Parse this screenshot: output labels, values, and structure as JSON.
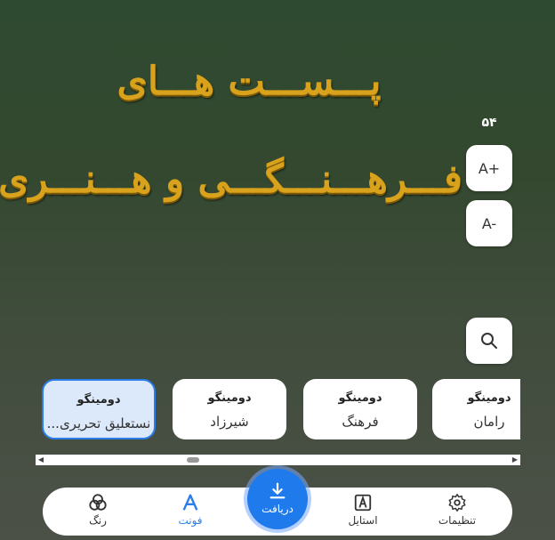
{
  "canvas": {
    "line1": "پـــســـت هـــای",
    "line2": "فـــرهـــنـــگـــی و هـــنـــری",
    "text_color": "#d9a21c"
  },
  "size_controls": {
    "current_size": "۵۴",
    "increase_label": "A+",
    "decrease_label": "A-"
  },
  "fonts": [
    {
      "preview": "دومینگو",
      "name": "رامان"
    },
    {
      "preview": "دومینگو",
      "name": "فرهنگ"
    },
    {
      "preview": "دومینگو",
      "name": "شیرزاد"
    },
    {
      "preview": "دومینگو",
      "name": "نستعلیق تحریری...",
      "selected": true
    }
  ],
  "nav": {
    "settings": "تنظیمات",
    "style": "استایل",
    "download": "دریافت",
    "font": "فونت",
    "color": "رنگ"
  },
  "colors": {
    "accent": "#2b7de9",
    "fab": "#1f7aec"
  }
}
